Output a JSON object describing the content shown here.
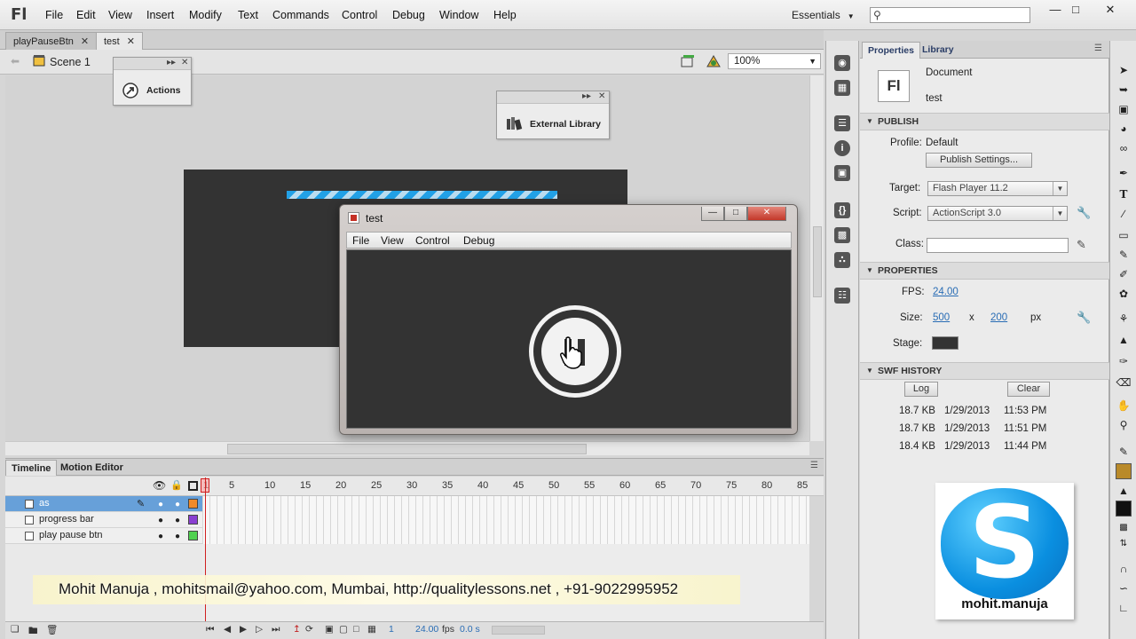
{
  "app": {
    "logo": "Fl"
  },
  "menu": [
    "File",
    "Edit",
    "View",
    "Insert",
    "Modify",
    "Text",
    "Commands",
    "Control",
    "Debug",
    "Window",
    "Help"
  ],
  "workspace": "Essentials",
  "search": {
    "placeholder": ""
  },
  "doc_tabs": [
    {
      "label": "playPauseBtn",
      "active": false
    },
    {
      "label": "test",
      "active": true
    }
  ],
  "editbar": {
    "scene": "Scene 1",
    "zoom": "100%"
  },
  "panels": {
    "actions": "Actions",
    "external_library": "External Library"
  },
  "test_window": {
    "title": "test",
    "menu": [
      "File",
      "View",
      "Control",
      "Debug"
    ]
  },
  "timeline": {
    "tabs": [
      "Timeline",
      "Motion Editor"
    ],
    "frame_numbers": [
      "1",
      "5",
      "10",
      "15",
      "20",
      "25",
      "30",
      "35",
      "40",
      "45",
      "50",
      "55",
      "60",
      "65",
      "70",
      "75",
      "80",
      "85"
    ],
    "layers": [
      {
        "name": "as",
        "color": "#f08a2a",
        "selected": true
      },
      {
        "name": "progress  bar",
        "color": "#8a3fd1",
        "selected": false
      },
      {
        "name": "play pause btn",
        "color": "#4fd14f",
        "selected": false
      }
    ],
    "status": {
      "frame": "1",
      "fps": "24.00",
      "fps_unit": "fps",
      "time": "0.0 s"
    }
  },
  "credits": "Mohit  Manuja , mohitsmail@yahoo.com, Mumbai, http://qualitylessons.net , +91-9022995952",
  "properties": {
    "tabs": [
      "Properties",
      "Library"
    ],
    "doc_type": "Document",
    "doc_name": "test",
    "doc_icon": "Fl",
    "publish": {
      "header": "PUBLISH",
      "profile_label": "Profile:",
      "profile_value": "Default",
      "settings_button": "Publish Settings...",
      "target_label": "Target:",
      "target_value": "Flash Player 11.2",
      "script_label": "Script:",
      "script_value": "ActionScript 3.0",
      "class_label": "Class:"
    },
    "props": {
      "header": "PROPERTIES",
      "fps_label": "FPS:",
      "fps_value": "24.00",
      "size_label": "Size:",
      "width": "500",
      "x_sep": "x",
      "height": "200",
      "unit": "px",
      "stage_label": "Stage:",
      "stage_color": "#333333"
    },
    "swf_history": {
      "header": "SWF HISTORY",
      "log_button": "Log",
      "clear_button": "Clear",
      "entries": [
        {
          "size": "18.7 KB",
          "date": "1/29/2013",
          "time": "11:53 PM"
        },
        {
          "size": "18.7 KB",
          "date": "1/29/2013",
          "time": "11:51 PM"
        },
        {
          "size": "18.4 KB",
          "date": "1/29/2013",
          "time": "11:44 PM"
        }
      ]
    }
  },
  "skype": {
    "letter": "S",
    "name": "mohit.manuja"
  }
}
